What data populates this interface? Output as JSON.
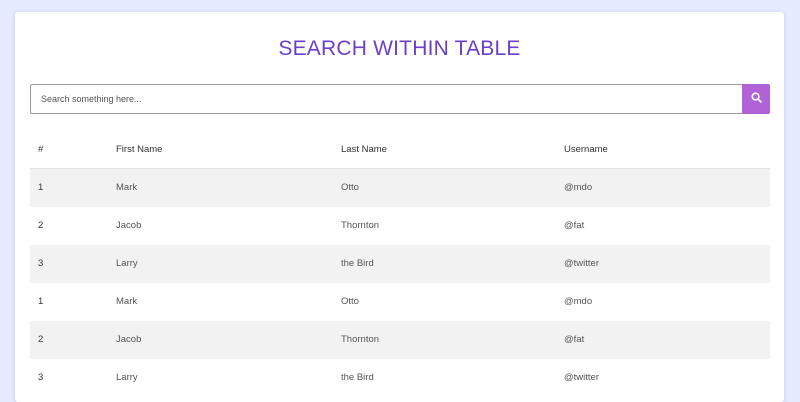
{
  "title": "SEARCH WITHIN TABLE",
  "search": {
    "placeholder": "Search something here...",
    "button_icon": "search-icon"
  },
  "colors": {
    "background": "#e6ebff",
    "title": "#6b3fc8",
    "search_button": "#b162d6",
    "stripe": "#f2f2f2"
  },
  "table": {
    "headers": [
      "#",
      "First Name",
      "Last Name",
      "Username"
    ],
    "rows": [
      [
        "1",
        "Mark",
        "Otto",
        "@mdo"
      ],
      [
        "2",
        "Jacob",
        "Thornton",
        "@fat"
      ],
      [
        "3",
        "Larry",
        "the Bird",
        "@twitter"
      ],
      [
        "1",
        "Mark",
        "Otto",
        "@mdo"
      ],
      [
        "2",
        "Jacob",
        "Thornton",
        "@fat"
      ],
      [
        "3",
        "Larry",
        "the Bird",
        "@twitter"
      ]
    ]
  }
}
